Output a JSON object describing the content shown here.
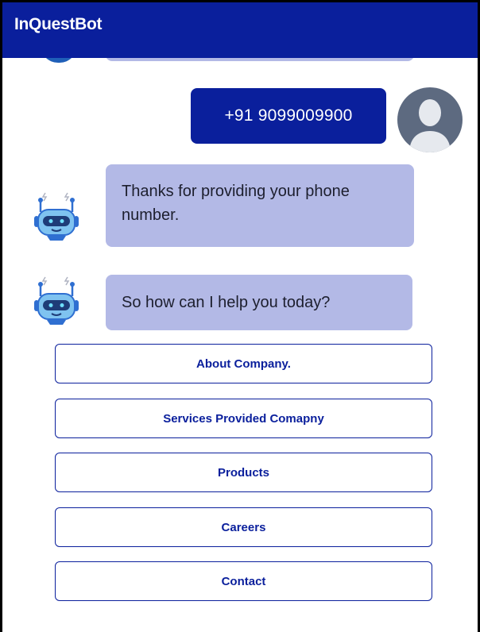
{
  "header": {
    "title": "InQuestBot"
  },
  "messages": {
    "user_phone": "+91 9099009900",
    "bot_thanks": "Thanks for providing your phone number.",
    "bot_help": "So how can I help you today?"
  },
  "options": [
    {
      "label": "About Company."
    },
    {
      "label": "Services Provided Comapny"
    },
    {
      "label": "Products"
    },
    {
      "label": "Careers"
    },
    {
      "label": "Contact"
    }
  ],
  "colors": {
    "header_bg": "#0a1f9c",
    "user_bubble": "#0a1f9c",
    "bot_bubble": "#b3b9e6",
    "option_border": "#0a1f9c"
  },
  "icons": {
    "bot_avatar": "robot-icon",
    "user_avatar": "user-avatar-icon"
  }
}
